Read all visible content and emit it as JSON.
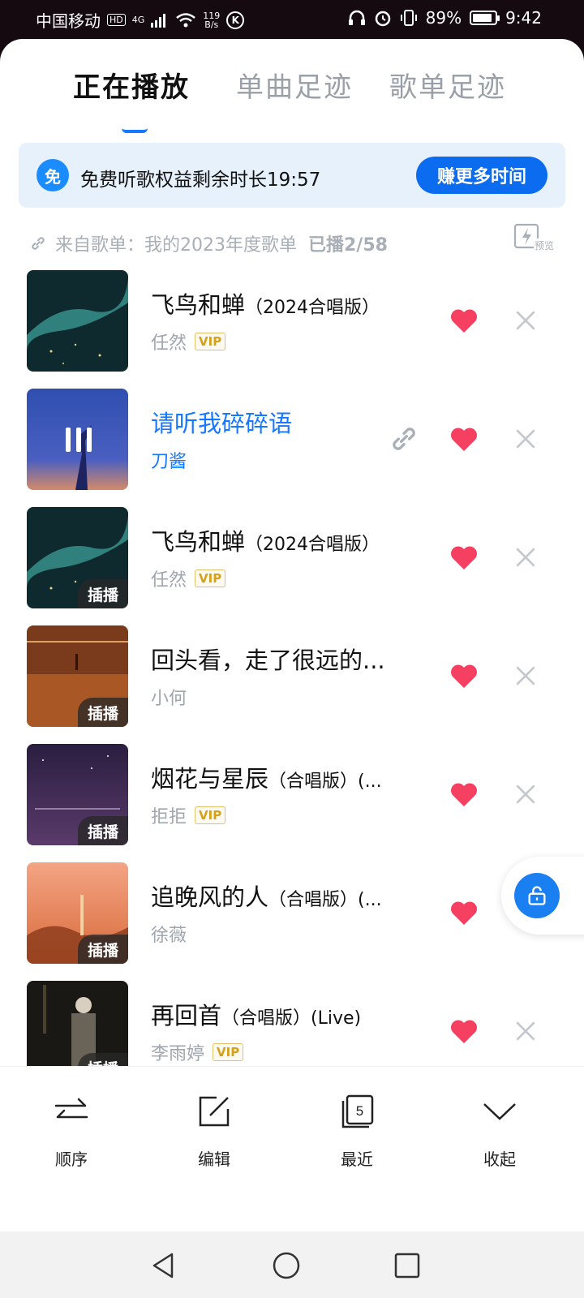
{
  "status_bar": {
    "carrier": "中国移动",
    "hd": "HD",
    "network": "4G",
    "speed_top": "119",
    "speed_bottom": "B/s",
    "k_icon": "K",
    "battery_percent": "89%",
    "battery_level": 0.89,
    "time": "9:42"
  },
  "tabs": [
    {
      "label": "正在播放",
      "active": true
    },
    {
      "label": "单曲足迹",
      "active": false
    },
    {
      "label": "歌单足迹",
      "active": false
    }
  ],
  "promo": {
    "icon": "免",
    "text": "免费听歌权益剩余时长19:57",
    "button": "赚更多时间"
  },
  "source": {
    "text": "来自歌单：我的2023年度歌单",
    "count": "已播2/58",
    "preview_label": "预览"
  },
  "songs": [
    {
      "title": "飞鸟和蝉",
      "suffix": "（2024合唱版）",
      "artist": "任然",
      "vip": "VIP",
      "tag": "",
      "playing": false
    },
    {
      "title": "请听我碎碎语",
      "suffix": "",
      "artist": "刀酱",
      "vip": "",
      "tag": "",
      "playing": true
    },
    {
      "title": "飞鸟和蝉",
      "suffix": "（2024合唱版）",
      "artist": "任然",
      "vip": "VIP",
      "tag": "插播",
      "playing": false
    },
    {
      "title": "回头看，走了很远的...",
      "suffix": "",
      "artist": "小何",
      "vip": "",
      "tag": "插播",
      "playing": false
    },
    {
      "title": "烟花与星辰",
      "suffix": "（合唱版）(...",
      "artist": "拒拒",
      "vip": "VIP",
      "tag": "插播",
      "playing": false
    },
    {
      "title": "追晚风的人",
      "suffix": "（合唱版）(...",
      "artist": "徐薇",
      "vip": "",
      "tag": "插播",
      "playing": false
    },
    {
      "title": "再回首",
      "suffix": "（合唱版）(Live)",
      "artist": "李雨婷",
      "vip": "VIP",
      "tag": "插播",
      "playing": false
    }
  ],
  "actions": {
    "order": "顺序",
    "edit": "编辑",
    "recent": "最近",
    "recent_badge": "5",
    "collapse": "收起"
  },
  "colors": {
    "accent": "#1677ff",
    "heart": "#f54062",
    "promo_bg": "#e6f1fb"
  }
}
